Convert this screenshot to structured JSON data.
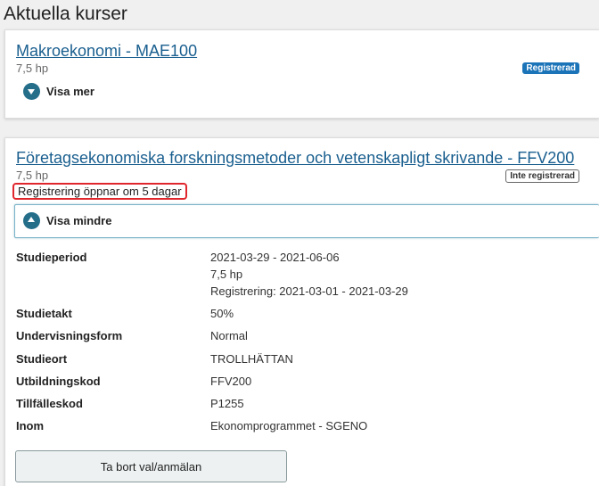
{
  "page_title": "Aktuella kurser",
  "courses": [
    {
      "title": "Makroekonomi - MAE100",
      "credits": "7,5 hp",
      "status_badge": "Registrerad",
      "toggle_label": "Visa mer"
    },
    {
      "title": "Företagsekonomiska forskningsmetoder och vetenskapligt skrivande - FFV200",
      "credits": "7,5 hp",
      "status_badge": "Inte registrerad",
      "registration_notice": "Registrering öppnar om 5 dagar",
      "toggle_label": "Visa mindre",
      "details": {
        "studieperiod_label": "Studieperiod",
        "studieperiod_value": "2021-03-29 - 2021-06-06",
        "studieperiod_credits": "7,5 hp",
        "studieperiod_registration": "Registrering: 2021-03-01 - 2021-03-29",
        "studietakt_label": "Studietakt",
        "studietakt_value": "50%",
        "undervisningsform_label": "Undervisningsform",
        "undervisningsform_value": "Normal",
        "studieort_label": "Studieort",
        "studieort_value": "TROLLHÄTTAN",
        "utbildningskod_label": "Utbildningskod",
        "utbildningskod_value": "FFV200",
        "tillfalleskod_label": "Tillfälleskod",
        "tillfalleskod_value": "P1255",
        "inom_label": "Inom",
        "inom_value": "Ekonomprogrammet - SGENO"
      },
      "remove_button_label": "Ta bort val/anmälan"
    }
  ],
  "colors": {
    "link": "#1a5f8f",
    "accent": "#246e8a",
    "badge_registered": "#1b73b8",
    "notice_border": "#e0262d"
  }
}
